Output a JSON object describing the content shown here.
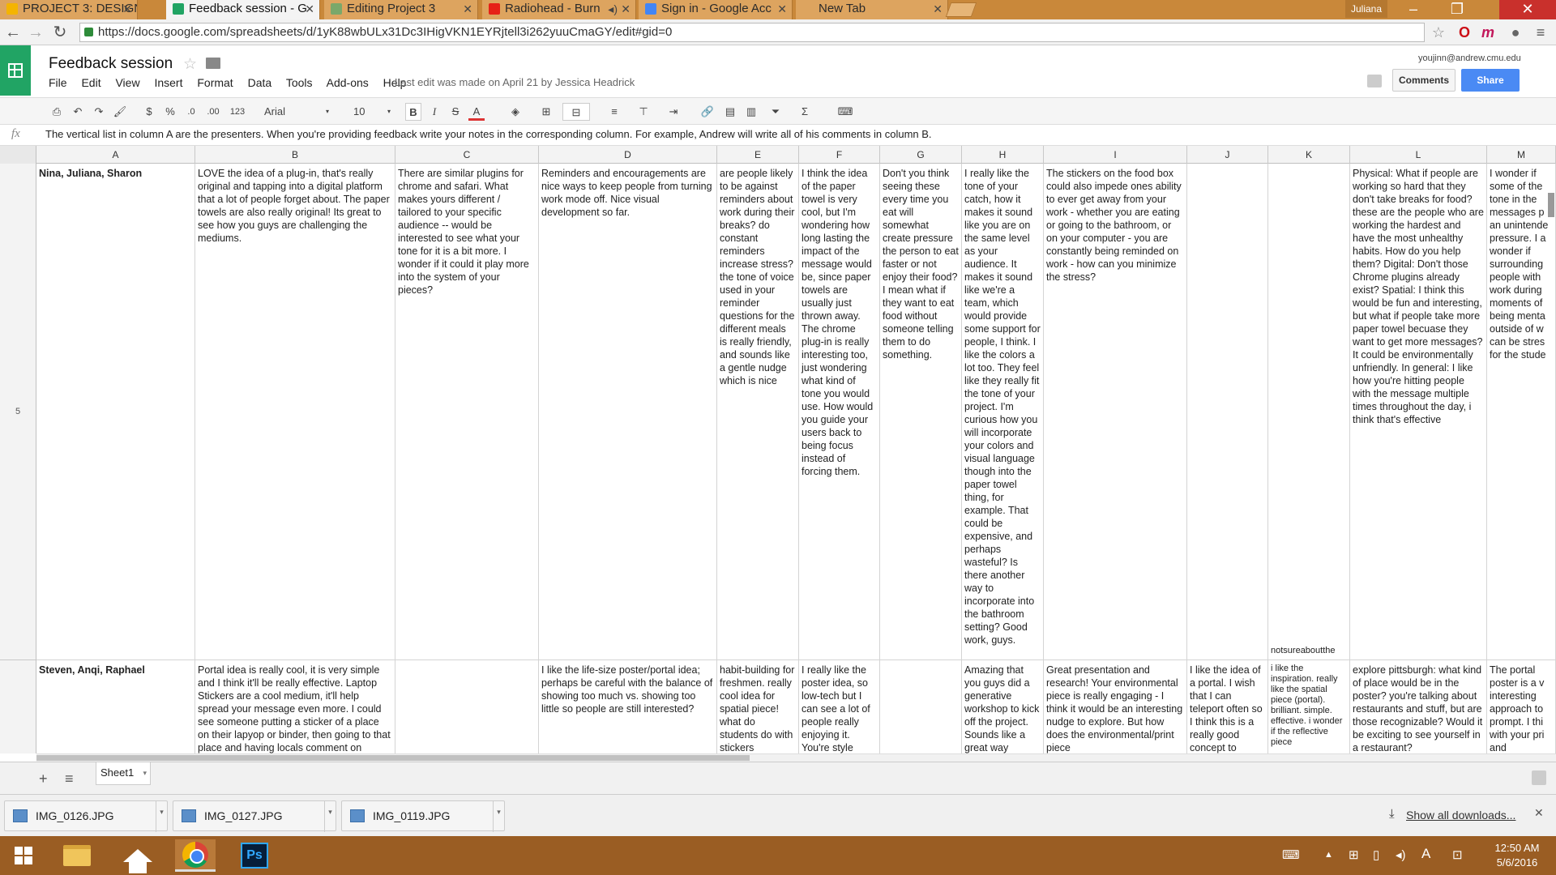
{
  "browser": {
    "tabs": [
      {
        "label": "PROJECT 3: DESIGNI",
        "favicon_color": "#f4b400",
        "active": false
      },
      {
        "label": "Feedback session - G",
        "favicon_color": "#21a464",
        "active": true
      },
      {
        "label": "Editing Project 3",
        "favicon_color": "#7aa86a",
        "active": false
      },
      {
        "label": "Radiohead - Burn",
        "favicon_color": "#e62117",
        "active": false
      },
      {
        "label": "Sign in - Google Acc",
        "favicon_color": "#4285f4",
        "active": false
      },
      {
        "label": "New Tab",
        "favicon_color": "",
        "active": false
      }
    ],
    "user_chip": "Juliana",
    "url": "https://docs.google.com/spreadsheets/d/1yK88wbULx31Dc3IHigVKN1EYRjtell3i262yuuCmaGY/edit#gid=0"
  },
  "doc": {
    "title": "Feedback session",
    "menu": [
      "File",
      "Edit",
      "View",
      "Insert",
      "Format",
      "Data",
      "Tools",
      "Add-ons",
      "Help"
    ],
    "last_edit": "Last edit was made on April 21 by Jessica Headrick",
    "account": "youjinn@andrew.cmu.edu",
    "comments_label": "Comments",
    "share_label": "Share"
  },
  "toolbar": {
    "currency": "$",
    "percent": "%",
    "dec_less": ".0",
    "dec_more": ".00",
    "more_formats": "123",
    "font": "Arial",
    "font_size": "10",
    "bold": "B",
    "italic": "I",
    "strike": "S",
    "text_color": "A",
    "sum": "Σ"
  },
  "formula_bar": {
    "fx": "fx",
    "content": "The vertical list in column A are the presenters. When you're providing feedback write your notes in the corresponding column. For example, Andrew will write all of his comments in column B."
  },
  "columns": [
    "A",
    "B",
    "C",
    "D",
    "E",
    "F",
    "G",
    "H",
    "I",
    "J",
    "K",
    "L",
    "M"
  ],
  "rows": [
    {
      "number": "5",
      "cells": [
        "Nina, Juliana, Sharon",
        "LOVE the idea of a plug-in, that's really original and tapping into a digital platform that a lot of people forget about. The paper towels are also really original! Its great to see how you guys are challenging the mediums.",
        "There are similar plugins for chrome and safari. What makes yours different / tailored to your specific audience -- would be interested to see what your tone for it is a bit more. I wonder if it could it play more into the system of your pieces?",
        "Reminders and encouragements are nice ways to keep people from turning work mode off. Nice visual development so far.",
        "are people likely to be against reminders about work during their breaks? do constant reminders increase stress? the tone of voice used in your reminder questions for the different meals is really friendly, and sounds like a gentle nudge which is nice",
        "I think the idea of the paper towel is very cool, but I'm wondering how long lasting the impact of the message would be, since paper towels are usually just thrown away. The chrome plug-in is really interesting too, just wondering what kind of tone you would use. How would you guide your users back to being focus instead of forcing them.",
        "Don't you think seeing these every time you eat will somewhat create pressure the person to eat faster or not enjoy their food? I mean what if they want to eat food without someone telling them to do something.",
        "I really like the tone of your catch, how it makes it sound like you are on the same level as your audience. It makes it sound like we're a team, which would provide some support for people, I think. I like the colors a lot too. They feel like they really fit the tone of your project. I'm curious how you will incorporate your colors and visual language though into the paper towel thing, for example. That could be expensive, and perhaps wasteful? Is there another way to incorporate into the bathroom setting? Good work, guys.",
        "The stickers on the food box could also impede ones ability to ever get away from your work - whether you are eating or going to the bathroom, or on your computer - you are constantly being reminded on work - how can you minimize the stress?",
        "",
        "notsureaboutthe",
        "Physical: What if people are working so hard that they don't take breaks for food? these are the people who are working the hardest and have the most unhealthy habits. How do you help them? Digital: Don't those Chrome plugins already exist? Spatial: I think this would be fun and interesting, but what if people take more paper towel becuase they want to get more messages? It could be environmentally unfriendly. In general: I like how you're hitting people with the message multiple times throughout the day, i think that's effective",
        "I wonder if some of the tone in the messages p an unintende pressure. I a wonder if surrounding people with work during moments of being menta outside of w can be stres for the stude"
      ]
    },
    {
      "number": "",
      "cells": [
        "Steven, Anqi, Raphael",
        "Portal idea is really cool, it is very simple and I think it'll be really effective. Laptop Stickers are a cool medium, it'll help spread your message even more. I could see someone putting a sticker of a place on their lapyop or binder, then going to that place and having locals comment on",
        "",
        "I like the life-size poster/portal idea; perhaps be careful with the balance of showing too much vs. showing too little so people are still interested?",
        "habit-building for freshmen. really cool idea for spatial piece! what do students do with stickers",
        "I really like the poster idea, so low-tech but I can see a lot of people really enjoying it. You're style",
        "",
        "Amazing that you guys did a generative workshop to kick off the project. Sounds like a great way",
        "Great presentation and research! Your environmental piece is really engaging - I think it would be an interesting nudge to explore. But how does the environmental/print piece",
        "I like the idea of a portal. I wish that I can teleport often so I think this is a really good concept to",
        "i like the inspiration. really like the spatial piece (portal). brilliant. simple. effective. i wonder if the reflective piece",
        "explore pittsburgh: what kind of place would be in the poster? you're talking about restaurants and stuff, but are those recognizable? Would it be exciting to see yourself in a restaurant?",
        "The portal poster is a v interesting approach to prompt. I thi with your pri and"
      ]
    }
  ],
  "sheet_tab": "Sheet1",
  "downloads": {
    "items": [
      "IMG_0126.JPG",
      "IMG_0127.JPG",
      "IMG_0119.JPG"
    ],
    "show_all": "Show all downloads..."
  },
  "taskbar": {
    "time": "12:50 AM",
    "date": "5/6/2016",
    "ps_label": "Ps",
    "ime": "A"
  }
}
